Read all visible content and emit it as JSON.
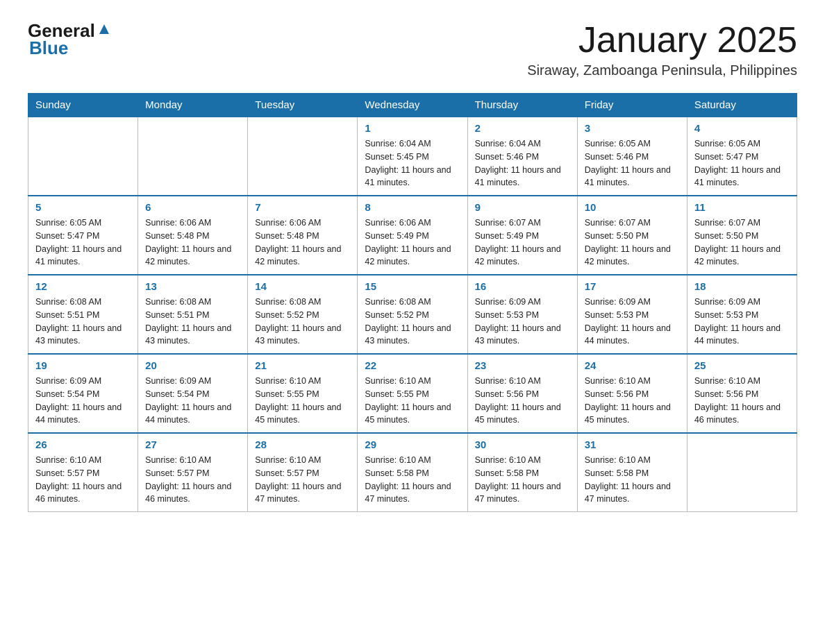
{
  "logo": {
    "text_general": "General",
    "text_blue": "Blue"
  },
  "title": "January 2025",
  "subtitle": "Siraway, Zamboanga Peninsula, Philippines",
  "days_of_week": [
    "Sunday",
    "Monday",
    "Tuesday",
    "Wednesday",
    "Thursday",
    "Friday",
    "Saturday"
  ],
  "weeks": [
    [
      {
        "day": "",
        "info": ""
      },
      {
        "day": "",
        "info": ""
      },
      {
        "day": "",
        "info": ""
      },
      {
        "day": "1",
        "info": "Sunrise: 6:04 AM\nSunset: 5:45 PM\nDaylight: 11 hours and 41 minutes."
      },
      {
        "day": "2",
        "info": "Sunrise: 6:04 AM\nSunset: 5:46 PM\nDaylight: 11 hours and 41 minutes."
      },
      {
        "day": "3",
        "info": "Sunrise: 6:05 AM\nSunset: 5:46 PM\nDaylight: 11 hours and 41 minutes."
      },
      {
        "day": "4",
        "info": "Sunrise: 6:05 AM\nSunset: 5:47 PM\nDaylight: 11 hours and 41 minutes."
      }
    ],
    [
      {
        "day": "5",
        "info": "Sunrise: 6:05 AM\nSunset: 5:47 PM\nDaylight: 11 hours and 41 minutes."
      },
      {
        "day": "6",
        "info": "Sunrise: 6:06 AM\nSunset: 5:48 PM\nDaylight: 11 hours and 42 minutes."
      },
      {
        "day": "7",
        "info": "Sunrise: 6:06 AM\nSunset: 5:48 PM\nDaylight: 11 hours and 42 minutes."
      },
      {
        "day": "8",
        "info": "Sunrise: 6:06 AM\nSunset: 5:49 PM\nDaylight: 11 hours and 42 minutes."
      },
      {
        "day": "9",
        "info": "Sunrise: 6:07 AM\nSunset: 5:49 PM\nDaylight: 11 hours and 42 minutes."
      },
      {
        "day": "10",
        "info": "Sunrise: 6:07 AM\nSunset: 5:50 PM\nDaylight: 11 hours and 42 minutes."
      },
      {
        "day": "11",
        "info": "Sunrise: 6:07 AM\nSunset: 5:50 PM\nDaylight: 11 hours and 42 minutes."
      }
    ],
    [
      {
        "day": "12",
        "info": "Sunrise: 6:08 AM\nSunset: 5:51 PM\nDaylight: 11 hours and 43 minutes."
      },
      {
        "day": "13",
        "info": "Sunrise: 6:08 AM\nSunset: 5:51 PM\nDaylight: 11 hours and 43 minutes."
      },
      {
        "day": "14",
        "info": "Sunrise: 6:08 AM\nSunset: 5:52 PM\nDaylight: 11 hours and 43 minutes."
      },
      {
        "day": "15",
        "info": "Sunrise: 6:08 AM\nSunset: 5:52 PM\nDaylight: 11 hours and 43 minutes."
      },
      {
        "day": "16",
        "info": "Sunrise: 6:09 AM\nSunset: 5:53 PM\nDaylight: 11 hours and 43 minutes."
      },
      {
        "day": "17",
        "info": "Sunrise: 6:09 AM\nSunset: 5:53 PM\nDaylight: 11 hours and 44 minutes."
      },
      {
        "day": "18",
        "info": "Sunrise: 6:09 AM\nSunset: 5:53 PM\nDaylight: 11 hours and 44 minutes."
      }
    ],
    [
      {
        "day": "19",
        "info": "Sunrise: 6:09 AM\nSunset: 5:54 PM\nDaylight: 11 hours and 44 minutes."
      },
      {
        "day": "20",
        "info": "Sunrise: 6:09 AM\nSunset: 5:54 PM\nDaylight: 11 hours and 44 minutes."
      },
      {
        "day": "21",
        "info": "Sunrise: 6:10 AM\nSunset: 5:55 PM\nDaylight: 11 hours and 45 minutes."
      },
      {
        "day": "22",
        "info": "Sunrise: 6:10 AM\nSunset: 5:55 PM\nDaylight: 11 hours and 45 minutes."
      },
      {
        "day": "23",
        "info": "Sunrise: 6:10 AM\nSunset: 5:56 PM\nDaylight: 11 hours and 45 minutes."
      },
      {
        "day": "24",
        "info": "Sunrise: 6:10 AM\nSunset: 5:56 PM\nDaylight: 11 hours and 45 minutes."
      },
      {
        "day": "25",
        "info": "Sunrise: 6:10 AM\nSunset: 5:56 PM\nDaylight: 11 hours and 46 minutes."
      }
    ],
    [
      {
        "day": "26",
        "info": "Sunrise: 6:10 AM\nSunset: 5:57 PM\nDaylight: 11 hours and 46 minutes."
      },
      {
        "day": "27",
        "info": "Sunrise: 6:10 AM\nSunset: 5:57 PM\nDaylight: 11 hours and 46 minutes."
      },
      {
        "day": "28",
        "info": "Sunrise: 6:10 AM\nSunset: 5:57 PM\nDaylight: 11 hours and 47 minutes."
      },
      {
        "day": "29",
        "info": "Sunrise: 6:10 AM\nSunset: 5:58 PM\nDaylight: 11 hours and 47 minutes."
      },
      {
        "day": "30",
        "info": "Sunrise: 6:10 AM\nSunset: 5:58 PM\nDaylight: 11 hours and 47 minutes."
      },
      {
        "day": "31",
        "info": "Sunrise: 6:10 AM\nSunset: 5:58 PM\nDaylight: 11 hours and 47 minutes."
      },
      {
        "day": "",
        "info": ""
      }
    ]
  ]
}
